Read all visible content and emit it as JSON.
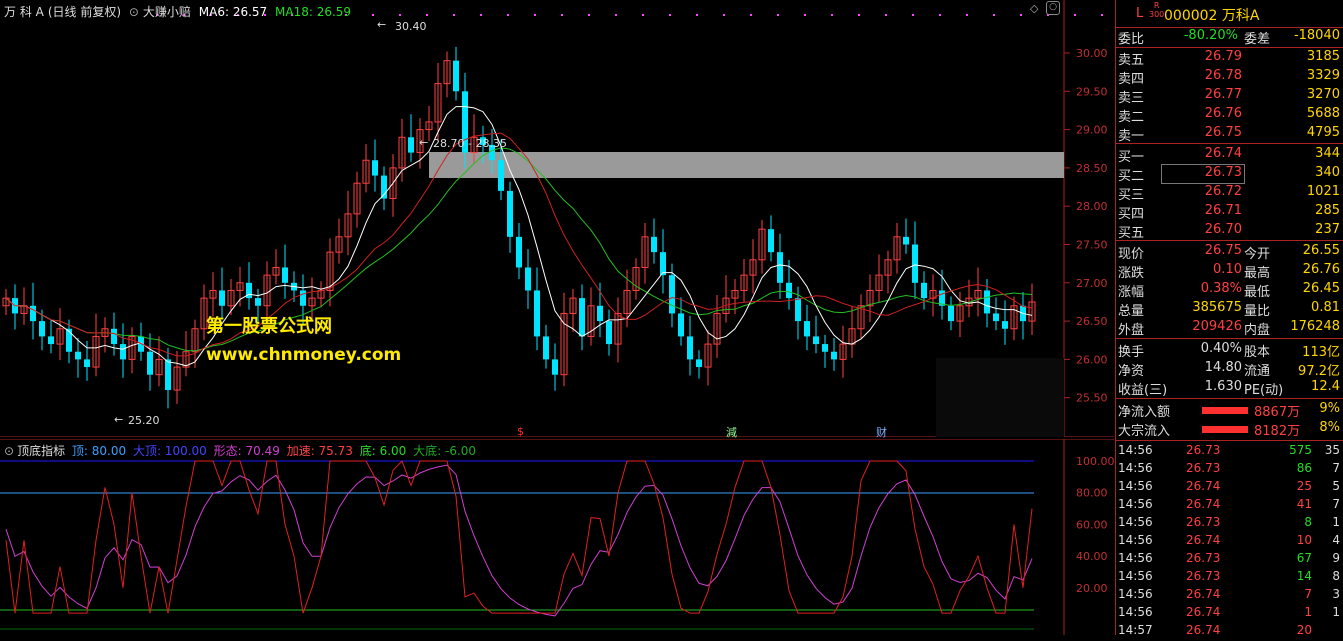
{
  "header": {
    "stock": "万 科 A",
    "period": "(日线 前复权)",
    "formula": "大赚小赔",
    "ma6": "MA6: 26.57",
    "ma18": "MA18: 26.59",
    "high_label": "30.40",
    "low_label": "25.20",
    "range_label": "28.70 - 28.35"
  },
  "watermark": {
    "line1": "第一股票公式网",
    "line2": "www.chnmoney.com"
  },
  "markers": {
    "s": "$",
    "j": "減",
    "c": "财"
  },
  "price_axis": [
    "30.00",
    "29.50",
    "29.00",
    "28.50",
    "28.00",
    "27.50",
    "27.00",
    "26.50",
    "26.00",
    "25.50"
  ],
  "indicator": {
    "name": "顶底指标",
    "top": "顶: 80.00",
    "bigtop": "大顶: 100.00",
    "form": "形态: 70.49",
    "speed": "加速: 75.73",
    "bottom": "底: 6.00",
    "bigbottom": "大底: -6.00",
    "axis": [
      "100.00",
      "80.00",
      "60.00",
      "40.00",
      "20.00"
    ]
  },
  "chart_data": {
    "type": "candlestick",
    "closes": [
      26.8,
      26.6,
      26.7,
      26.5,
      26.3,
      26.2,
      26.4,
      26.1,
      26.0,
      25.9,
      26.3,
      26.4,
      26.2,
      26.0,
      26.3,
      26.1,
      25.8,
      26.0,
      25.6,
      25.9,
      26.1,
      26.4,
      26.8,
      26.9,
      26.7,
      26.9,
      27.0,
      26.8,
      26.7,
      27.1,
      27.2,
      27.0,
      26.9,
      26.7,
      26.8,
      26.9,
      27.4,
      27.6,
      27.9,
      28.3,
      28.6,
      28.4,
      28.1,
      28.5,
      28.9,
      28.7,
      29.0,
      29.1,
      29.6,
      29.9,
      29.5,
      28.7,
      28.9,
      28.8,
      28.6,
      28.2,
      27.6,
      27.2,
      26.9,
      26.3,
      26.0,
      25.8,
      26.6,
      26.8,
      26.3,
      26.7,
      26.5,
      26.2,
      26.6,
      26.9,
      27.2,
      27.6,
      27.4,
      27.1,
      26.6,
      26.3,
      26.0,
      25.9,
      26.2,
      26.6,
      26.8,
      26.9,
      27.1,
      27.3,
      27.7,
      27.4,
      27.0,
      26.8,
      26.5,
      26.3,
      26.2,
      26.1,
      26.0,
      26.2,
      26.4,
      26.7,
      26.9,
      27.1,
      27.3,
      27.6,
      27.5,
      27.0,
      26.8,
      26.9,
      26.7,
      26.5,
      26.7,
      26.8,
      26.9,
      26.6,
      26.5,
      26.4,
      26.7,
      26.5,
      26.75
    ]
  },
  "level2": {
    "title": "000002 万科A",
    "badge_top": "R",
    "badge_bottom": "300",
    "weibi_label": "委比",
    "weibi": "-80.20%",
    "weicha_label": "委差",
    "weicha": "-18040",
    "asks": [
      {
        "label": "卖五",
        "price": "26.79",
        "vol": "3185"
      },
      {
        "label": "卖四",
        "price": "26.78",
        "vol": "3329"
      },
      {
        "label": "卖三",
        "price": "26.77",
        "vol": "3270"
      },
      {
        "label": "卖二",
        "price": "26.76",
        "vol": "5688"
      },
      {
        "label": "卖一",
        "price": "26.75",
        "vol": "4795"
      }
    ],
    "bids": [
      {
        "label": "买一",
        "price": "26.74",
        "vol": "344"
      },
      {
        "label": "买二",
        "price": "26.73",
        "vol": "340"
      },
      {
        "label": "买三",
        "price": "26.72",
        "vol": "1021"
      },
      {
        "label": "买四",
        "price": "26.71",
        "vol": "285"
      },
      {
        "label": "买五",
        "price": "26.70",
        "vol": "237"
      }
    ],
    "quote": [
      {
        "l1": "现价",
        "v1": "26.75",
        "c1": "red",
        "l2": "今开",
        "v2": "26.55",
        "c2": "grn"
      },
      {
        "l1": "涨跌",
        "v1": "0.10",
        "c1": "red",
        "l2": "最高",
        "v2": "26.76",
        "c2": "red"
      },
      {
        "l1": "涨幅",
        "v1": "0.38%",
        "c1": "red",
        "l2": "最低",
        "v2": "26.45",
        "c2": "grn"
      },
      {
        "l1": "总量",
        "v1": "385675",
        "c1": "yel",
        "l2": "量比",
        "v2": "0.81",
        "c2": "grn"
      },
      {
        "l1": "外盘",
        "v1": "209426",
        "c1": "red",
        "l2": "内盘",
        "v2": "176248",
        "c2": "grn"
      }
    ],
    "finance": [
      {
        "l1": "换手",
        "v1": "0.40%",
        "l2": "股本",
        "v2": "113亿"
      },
      {
        "l1": "净资",
        "v1": "14.80",
        "l2": "流通",
        "v2": "97.2亿"
      },
      {
        "l1": "收益(三)",
        "v1": "1.630",
        "l2": "PE(动)",
        "v2": "12.4"
      }
    ],
    "flows": [
      {
        "label": "净流入额",
        "val": "8867万",
        "pct": "9%"
      },
      {
        "label": "大宗流入",
        "val": "8182万",
        "pct": "8%"
      }
    ],
    "ticks": [
      {
        "t": "14:56",
        "p": "26.73",
        "pc": "red",
        "v": "575",
        "vc": "grn",
        "n": "35"
      },
      {
        "t": "14:56",
        "p": "26.73",
        "pc": "red",
        "v": "86",
        "vc": "grn",
        "n": "7"
      },
      {
        "t": "14:56",
        "p": "26.74",
        "pc": "red",
        "v": "25",
        "vc": "red",
        "n": "5"
      },
      {
        "t": "14:56",
        "p": "26.74",
        "pc": "red",
        "v": "41",
        "vc": "red",
        "n": "7"
      },
      {
        "t": "14:56",
        "p": "26.73",
        "pc": "red",
        "v": "8",
        "vc": "grn",
        "n": "1"
      },
      {
        "t": "14:56",
        "p": "26.74",
        "pc": "red",
        "v": "10",
        "vc": "red",
        "n": "4"
      },
      {
        "t": "14:56",
        "p": "26.73",
        "pc": "red",
        "v": "67",
        "vc": "grn",
        "n": "9"
      },
      {
        "t": "14:56",
        "p": "26.73",
        "pc": "red",
        "v": "14",
        "vc": "grn",
        "n": "8"
      },
      {
        "t": "14:56",
        "p": "26.74",
        "pc": "red",
        "v": "7",
        "vc": "red",
        "n": "3"
      },
      {
        "t": "14:56",
        "p": "26.74",
        "pc": "red",
        "v": "1",
        "vc": "red",
        "n": "1"
      },
      {
        "t": "14:57",
        "p": "26.74",
        "pc": "red",
        "v": "20",
        "vc": "red",
        "n": ""
      }
    ]
  }
}
